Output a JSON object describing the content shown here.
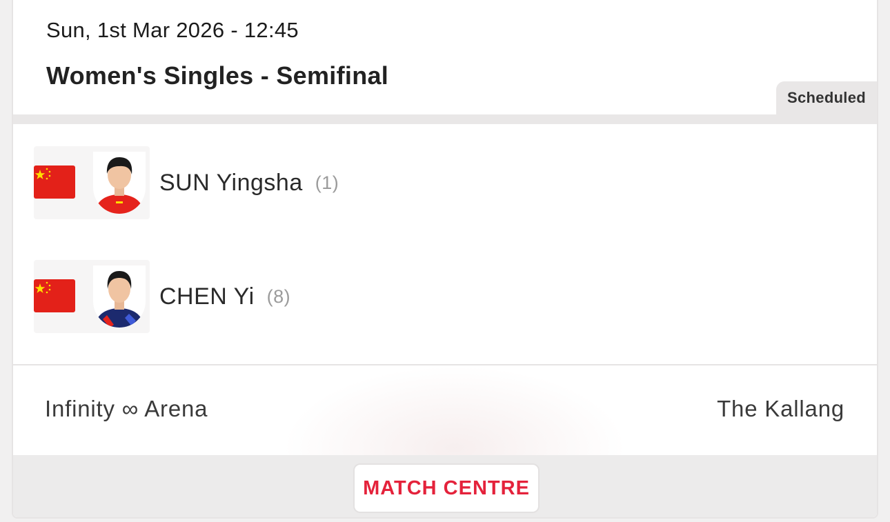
{
  "match": {
    "datetime": "Sun, 1st Mar 2026 - 12:45",
    "title": "Women's Singles - Semifinal",
    "status": "Scheduled"
  },
  "players": [
    {
      "name": "SUN Yingsha",
      "seed": "(1)",
      "flag": "china-flag-icon",
      "avatar": "player-photo"
    },
    {
      "name": "CHEN Yi",
      "seed": "(8)",
      "flag": "china-flag-icon",
      "avatar": "player-photo"
    }
  ],
  "venue": {
    "left": "Infinity ∞ Arena",
    "right": "The Kallang"
  },
  "footer": {
    "button_label": "MATCH CENTRE"
  },
  "colors": {
    "accent": "#e4223b",
    "flag_red": "#e32119",
    "flag_star": "#ffde00",
    "badge_bg": "#e9e7e7"
  }
}
